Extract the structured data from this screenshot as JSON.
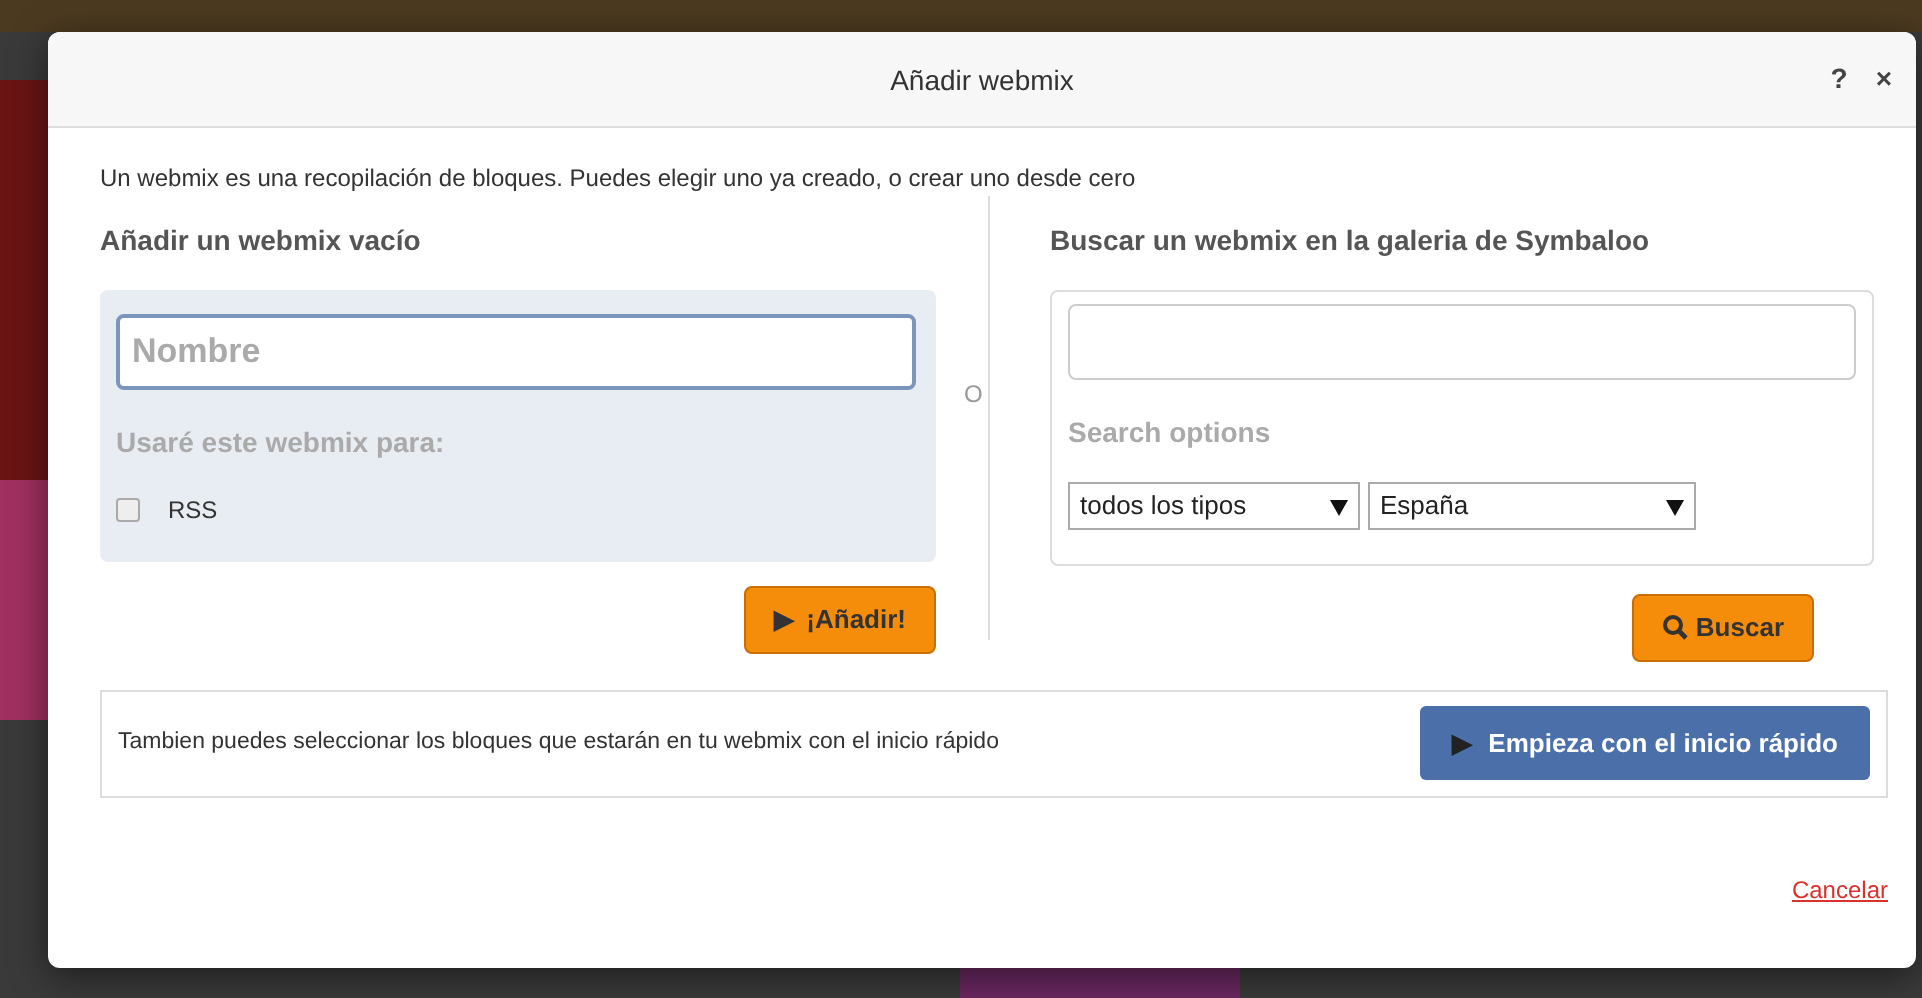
{
  "dialog": {
    "title": "Añadir webmix",
    "help": "?",
    "close": "×"
  },
  "intro": "Un webmix es una recopilación de bloques. Puedes elegir uno ya creado, o crear uno desde cero",
  "left": {
    "heading": "Añadir un webmix vacío",
    "name_field": {
      "placeholder": "Nombre"
    },
    "usage_label": "Usaré este webmix para:",
    "options": [
      {
        "label": "RSS",
        "checked": false
      }
    ],
    "button": {
      "icon": "▶",
      "label": "¡Añadir!"
    }
  },
  "separator": "O",
  "right": {
    "heading": "Buscar un webmix en la galeria de Symbaloo",
    "options_label": "Search options",
    "selects": [
      {
        "value": "todos los tipos"
      },
      {
        "value": "España"
      }
    ],
    "button": {
      "label": "Buscar"
    }
  },
  "quickstart": {
    "text": "Tambien puedes seleccionar los bloques que estarán en tu webmix con el inicio rápido",
    "button": {
      "icon": "▶",
      "label": "Empieza con el inicio rápido"
    }
  },
  "cancel": "Cancelar"
}
